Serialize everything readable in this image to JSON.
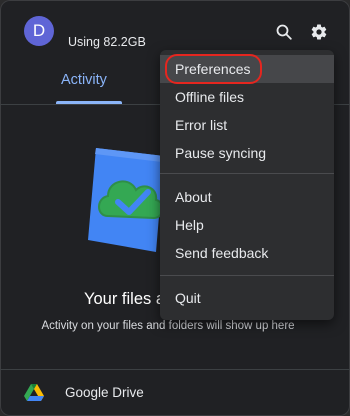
{
  "header": {
    "avatar_letter": "D",
    "storage_text": "Using 82.2GB",
    "search_icon": "search-icon",
    "settings_icon": "gear-icon"
  },
  "tabs": [
    {
      "label": "Activity",
      "selected": true
    }
  ],
  "empty_state": {
    "title": "Your files a",
    "subtitle": "Activity on your files and folders will show up here"
  },
  "footer": {
    "app_name": "Google Drive"
  },
  "menu": {
    "group1": [
      "Preferences",
      "Offline files",
      "Error list",
      "Pause syncing"
    ],
    "group2": [
      "About",
      "Help",
      "Send feedback"
    ],
    "group3": [
      "Quit"
    ],
    "highlighted": "Preferences"
  },
  "colors": {
    "accent": "#8ab4f8",
    "avatar": "#5f65d6",
    "highlight_ring": "#e5261f"
  }
}
